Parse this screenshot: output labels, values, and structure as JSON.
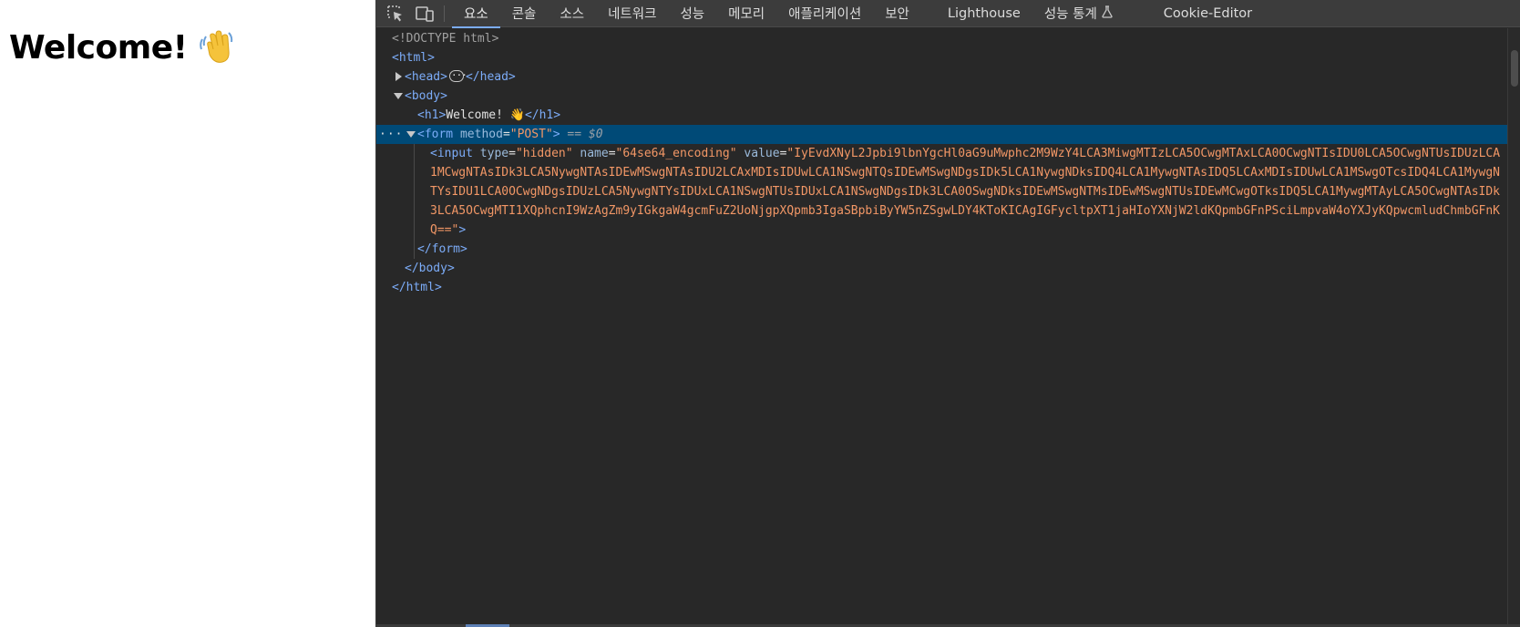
{
  "page": {
    "heading": "Welcome!",
    "emoji": "👋"
  },
  "devtools": {
    "toolbar": {
      "inspect_icon": "inspect-element-icon",
      "device_icon": "device-toolbar-icon",
      "tabs": [
        {
          "label": "요소",
          "active": true
        },
        {
          "label": "콘솔"
        },
        {
          "label": "소스"
        },
        {
          "label": "네트워크"
        },
        {
          "label": "성능"
        },
        {
          "label": "메모리"
        },
        {
          "label": "애플리케이션"
        },
        {
          "label": "보안"
        },
        {
          "label": "Lighthouse"
        },
        {
          "label": "성능 통계"
        },
        {
          "label": "Cookie-Editor"
        }
      ]
    },
    "dom": {
      "doctype": "<!DOCTYPE html>",
      "html_open": "<html>",
      "head_open": "<head>",
      "head_close": "</head>",
      "body_open": "<body>",
      "h1_open": "<h1>",
      "h1_text": "Welcome! 👋",
      "h1_close": "</h1>",
      "form_tag": "<form",
      "form_attr_name": "method",
      "form_attr_value": "\"POST\"",
      "form_close_bracket": ">",
      "selected_marker": "== $0",
      "input_tag": "<input",
      "input_attr1_name": "type",
      "input_attr1_value": "\"hidden\"",
      "input_attr2_name": "name",
      "input_attr2_value": "\"64se64_encoding\"",
      "input_attr3_name": "value",
      "input_value": "\"IyEvdXNyL2Jpbi9lbnYgcHl0aG9uMwphc2M9WzY4LCA3MiwgMTIzLCA5OCwgMTAxLCA0OCwgNTIsIDU0LCA5OCwgNTUsIDUzLCA1MCwgNTAsIDk3LCA5NywgNTAsIDEwMSwgNTAsIDU2LCAxMDIsIDUwLCA1NSwgNTQsIDEwMSwgNDgsIDk5LCA1NywgNDksIDQ4LCA1MywgNTAsIDQ5LCAxMDIsIDUwLCA1MSwgOTcsIDQ4LCA1MywgNTYsIDU1LCA0OCwgNDgsIDUzLCA5NywgNTYsIDUxLCA1NSwgNTUsIDUxLCA1NSwgNDgsIDk3LCA0OSwgNDksIDEwMSwgNTMsIDEwMSwgNTUsIDEwMCwgOTksIDQ5LCA1MywgMTAyLCA5OCwgNTAsIDk3LCA5OCwgMTI1XQphcnI9WzAgZm9yIGkgaW4gcmFuZ2UoNjgpXQpmb3IgaSBpbiByYW5nZSgwLDY4KToKICAgIGFycltpXT1jaHIoYXNjW2ldKQpmbGFnPSciLmpvaW4oYXJyKQpwcmludChmbGFnKQ==\"",
      "input_close_bracket": ">",
      "form_close": "</form>",
      "body_close": "</body>",
      "html_close": "</html>",
      "ellipsis": "···"
    }
  },
  "colors": {
    "tag": "#7cacf8",
    "attr_name": "#9bbbdc",
    "attr_value": "#f29766",
    "selected_row": "#004a77",
    "panel_bg": "#282828",
    "toolbar_bg": "#3c3c3c"
  }
}
